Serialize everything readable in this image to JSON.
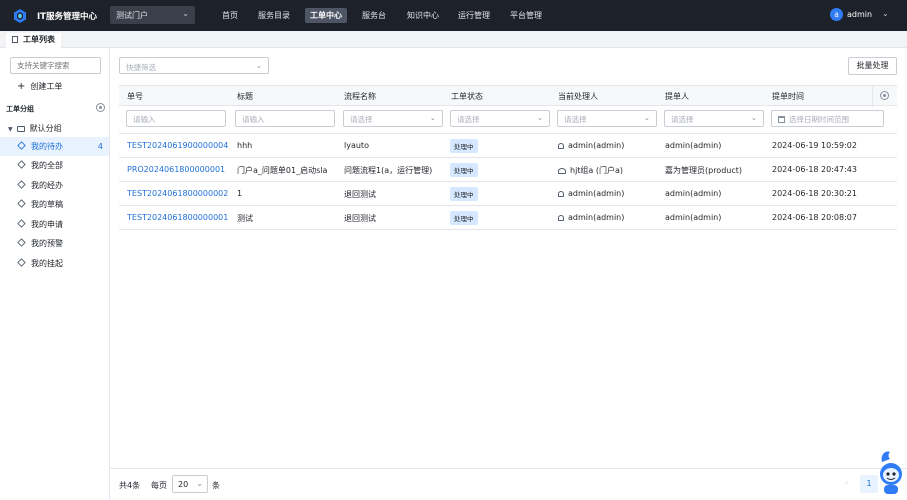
{
  "app": {
    "title": "IT服务管理中心"
  },
  "portal": {
    "selected": "测试门户"
  },
  "nav": [
    {
      "label": "首页",
      "active": false
    },
    {
      "label": "服务目录",
      "active": false
    },
    {
      "label": "工单中心",
      "active": true
    },
    {
      "label": "服务台",
      "active": false
    },
    {
      "label": "知识中心",
      "active": false
    },
    {
      "label": "运行管理",
      "active": false
    },
    {
      "label": "平台管理",
      "active": false
    }
  ],
  "user": {
    "avatar_letter": "a",
    "name": "admin"
  },
  "tabs": [
    {
      "label": "工单列表"
    }
  ],
  "sidebar": {
    "search_placeholder": "支持关键字搜索",
    "create_label": "创建工单",
    "group_title": "工单分组",
    "folder_label": "默认分组",
    "items": [
      {
        "label": "我的待办",
        "count": "4",
        "active": true
      },
      {
        "label": "我的全部",
        "count": "",
        "active": false
      },
      {
        "label": "我的经办",
        "count": "",
        "active": false
      },
      {
        "label": "我的草稿",
        "count": "",
        "active": false
      },
      {
        "label": "我的申请",
        "count": "",
        "active": false
      },
      {
        "label": "我的预警",
        "count": "",
        "active": false
      },
      {
        "label": "我的挂起",
        "count": "",
        "active": false
      }
    ]
  },
  "toolbar": {
    "quick_filter_placeholder": "快捷筛选",
    "batch_label": "批量处理"
  },
  "table": {
    "columns": [
      "单号",
      "标题",
      "流程名称",
      "工单状态",
      "当前处理人",
      "提单人",
      "提单时间"
    ],
    "filters": [
      "请输入",
      "请输入",
      "请选择",
      "请选择",
      "请选择",
      "请选择",
      "选择日期时间范围"
    ],
    "rows": [
      {
        "id": "TEST2024061900000004",
        "title": "hhh",
        "flow": "lyauto",
        "status": "处理中",
        "handler": "admin(admin)",
        "handler_icon": "user-icon",
        "submitter": "admin(admin)",
        "time": "2024-06-19 10:59:02"
      },
      {
        "id": "PRO2024061800000001",
        "title": "门户a_问题单01_启动sla",
        "flow": "问题流程1(a，运行管理)",
        "status": "处理中",
        "handler": "hjt组a (门户a)",
        "handler_icon": "group-icon",
        "submitter": "嘉为管理员(product)",
        "time": "2024-06-18 20:47:43"
      },
      {
        "id": "TEST2024061800000002",
        "title": "1",
        "flow": "退回测试",
        "status": "处理中",
        "handler": "admin(admin)",
        "handler_icon": "user-icon",
        "submitter": "admin(admin)",
        "time": "2024-06-18 20:30:21"
      },
      {
        "id": "TEST2024061800000001",
        "title": "测试",
        "flow": "退回测试",
        "status": "处理中",
        "handler": "admin(admin)",
        "handler_icon": "user-icon",
        "submitter": "admin(admin)",
        "time": "2024-06-18 20:08:07"
      }
    ]
  },
  "pagination": {
    "total": "共4条",
    "per_page_label": "每页",
    "page_size": "20",
    "unit": "条",
    "prev": "‹",
    "current_page": "1"
  },
  "colors": {
    "topbar": "#1d2129",
    "accent": "#1f6fd6",
    "badge": "#d6e8ff"
  }
}
